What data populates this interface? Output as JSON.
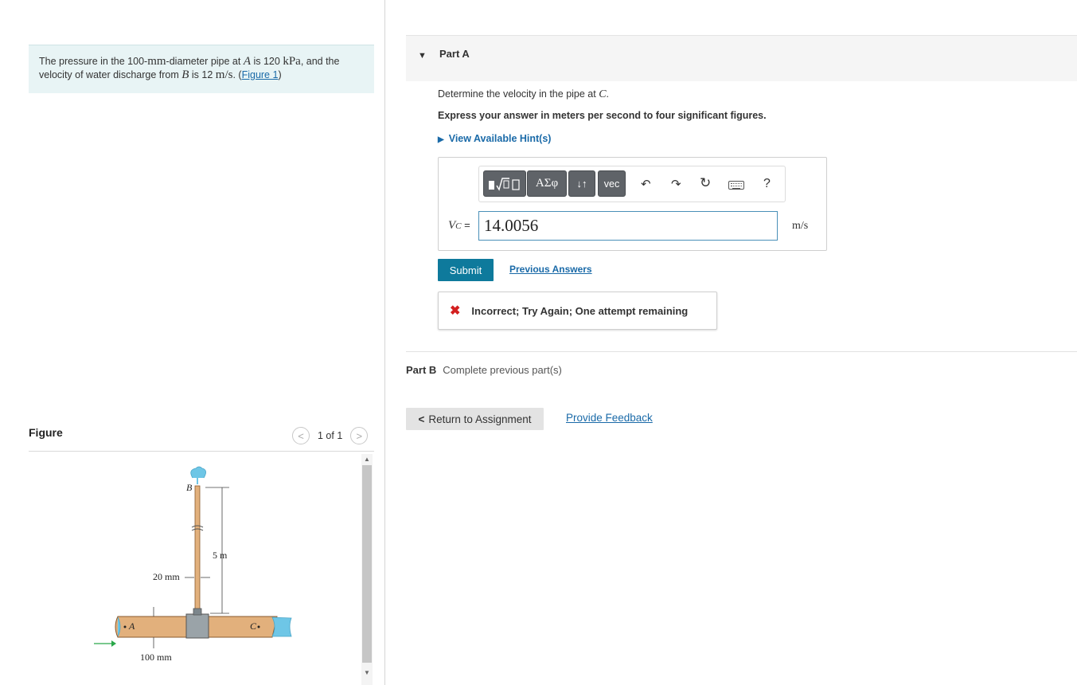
{
  "problem": {
    "text_1": "The pressure in the 100-",
    "unit_mm": "mm",
    "text_2": "-diameter pipe at ",
    "var_A": "A",
    "text_3": " is 120 ",
    "unit_kPa": "kPa",
    "text_4": ", and the velocity of water discharge from ",
    "var_B": "B",
    "text_5": " is 12 ",
    "unit_ms": "m/s",
    "text_6": ". (",
    "figure_link": "Figure 1",
    "text_7": ")"
  },
  "figure": {
    "title": "Figure",
    "page": "1 of 1",
    "labels": {
      "B": "B",
      "height": "5 m",
      "small_dia": "20 mm",
      "A": "A",
      "C": "C",
      "large_dia": "100 mm"
    }
  },
  "partA": {
    "title": "Part A",
    "question_prefix": "Determine the velocity in the pipe at ",
    "question_var": "C",
    "question_suffix": ".",
    "instructions": "Express your answer in meters per second to four significant figures.",
    "hints": "View Available Hint(s)",
    "toolbar": {
      "greek": "ΑΣφ",
      "arrows": "↓↑",
      "vec": "vec",
      "help": "?"
    },
    "var_label_main": "V",
    "var_label_sub": "C",
    "var_label_eq": " =",
    "answer_value": "14.0056",
    "unit": "m/s",
    "submit": "Submit",
    "previous_answers": "Previous Answers",
    "feedback": "Incorrect; Try Again; One attempt remaining"
  },
  "partB": {
    "title": "Part B",
    "status": "Complete previous part(s)"
  },
  "footer": {
    "return": "Return to Assignment",
    "feedback_link": "Provide Feedback"
  },
  "colors": {
    "accent": "#0e7a9c",
    "link": "#1a6aa8",
    "error": "#d32020",
    "problem_bg": "#e8f4f5"
  }
}
